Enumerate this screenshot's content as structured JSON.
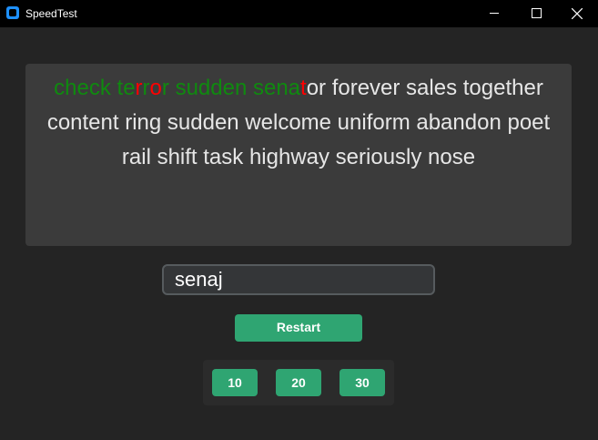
{
  "window": {
    "title": "SpeedTest"
  },
  "text_panel": {
    "line1": {
      "ok1": "check te",
      "err1": "r",
      "ok2": "r",
      "err2": "o",
      "ok3": "r sudden sena",
      "err3": "t",
      "rest": "or forever sales together"
    },
    "line2": "content ring sudden welcome uniform abandon poet",
    "line3": "rail shift task highway seriously nose"
  },
  "input": {
    "value": "senaj"
  },
  "buttons": {
    "restart": "Restart",
    "durations": [
      "10",
      "20",
      "30"
    ]
  },
  "colors": {
    "correct": "#0f8a0f",
    "incorrect": "#ff0000",
    "accent": "#2fa572"
  }
}
